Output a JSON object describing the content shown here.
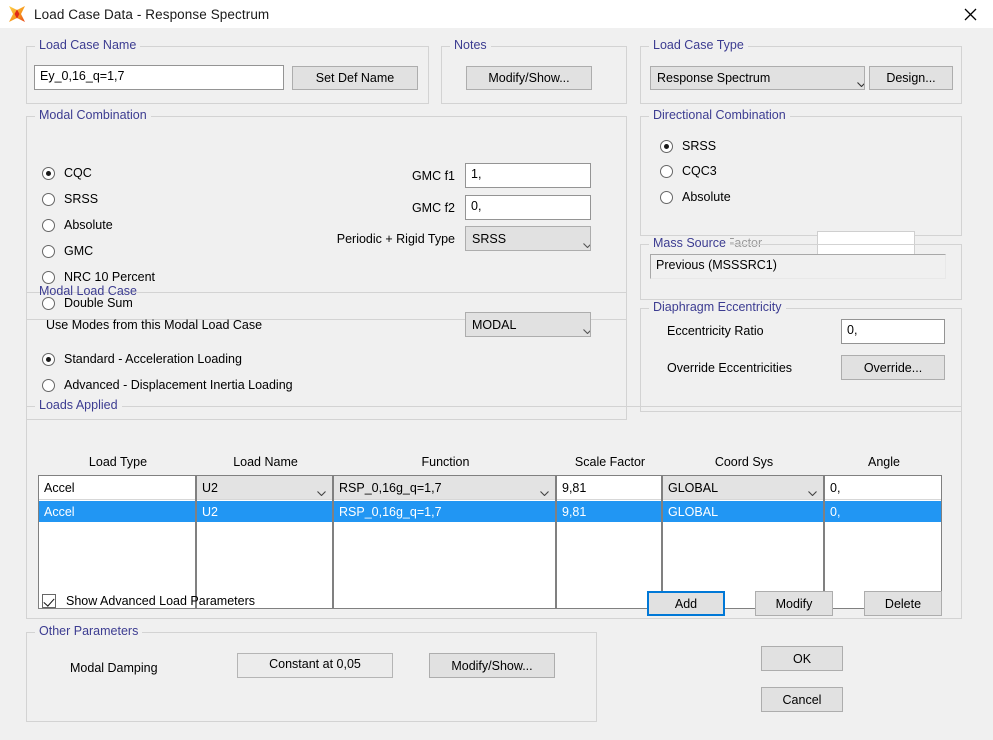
{
  "window": {
    "title": "Load Case Data - Response Spectrum",
    "app_icon": "csi-star-icon",
    "close_icon": "close-icon"
  },
  "load_case_name": {
    "legend": "Load Case Name",
    "value": "Ey_0,16_q=1,7",
    "set_def_name_label": "Set Def Name"
  },
  "notes": {
    "legend": "Notes",
    "modify_show_label": "Modify/Show..."
  },
  "load_case_type": {
    "legend": "Load Case Type",
    "selected": "Response Spectrum",
    "design_label": "Design..."
  },
  "modal_combination": {
    "legend": "Modal Combination",
    "options": [
      {
        "label": "CQC",
        "selected": true
      },
      {
        "label": "SRSS",
        "selected": false
      },
      {
        "label": "Absolute",
        "selected": false
      },
      {
        "label": "GMC",
        "selected": false
      },
      {
        "label": "NRC 10 Percent",
        "selected": false
      },
      {
        "label": "Double Sum",
        "selected": false
      }
    ],
    "gmc_f1_label": "GMC  f1",
    "gmc_f1_value": "1,",
    "gmc_f2_label": "GMC  f2",
    "gmc_f2_value": "0,",
    "periodic_rigid_label": "Periodic + Rigid Type",
    "periodic_rigid_value": "SRSS"
  },
  "modal_load_case": {
    "legend": "Modal Load Case",
    "use_modes_label": "Use Modes from this Modal Load Case",
    "modal_case_value": "MODAL",
    "options": [
      {
        "label": "Standard - Acceleration Loading",
        "selected": true
      },
      {
        "label": "Advanced - Displacement Inertia Loading",
        "selected": false
      }
    ]
  },
  "directional_combination": {
    "legend": "Directional Combination",
    "options": [
      {
        "label": "SRSS",
        "selected": true
      },
      {
        "label": "CQC3",
        "selected": false
      },
      {
        "label": "Absolute",
        "selected": false
      }
    ],
    "scale_factor_label": "Scale Factor",
    "scale_factor_value": ""
  },
  "mass_source": {
    "legend": "Mass Source",
    "value": "Previous  (MSSSRC1)"
  },
  "diaphragm_eccentricity": {
    "legend": "Diaphragm Eccentricity",
    "eccentricity_ratio_label": "Eccentricity Ratio",
    "eccentricity_ratio_value": "0,",
    "override_eccentricities_label": "Override Eccentricities",
    "override_button_label": "Override..."
  },
  "loads_applied": {
    "legend": "Loads Applied",
    "columns": [
      "Load Type",
      "Load Name",
      "Function",
      "Scale Factor",
      "Coord Sys",
      "Angle"
    ],
    "input_row": {
      "load_type": "Accel",
      "load_name": "U2",
      "function": "RSP_0,16g_q=1,7",
      "scale_factor": "9,81",
      "coord_sys": "GLOBAL",
      "angle": "0,"
    },
    "rows": [
      {
        "load_type": "Accel",
        "load_name": "U2",
        "function": "RSP_0,16g_q=1,7",
        "scale_factor": "9,81",
        "coord_sys": "GLOBAL",
        "angle": "0,",
        "selected": true
      }
    ],
    "show_advanced_label": "Show Advanced Load Parameters",
    "show_advanced_checked": true,
    "add_label": "Add",
    "modify_label": "Modify",
    "delete_label": "Delete"
  },
  "other_parameters": {
    "legend": "Other Parameters",
    "modal_damping_label": "Modal Damping",
    "modal_damping_value": "Constant at 0,05",
    "modify_show_label": "Modify/Show..."
  },
  "dialog_buttons": {
    "ok_label": "OK",
    "cancel_label": "Cancel"
  },
  "colors": {
    "legend_text": "#3c3c91",
    "selection": "#2196f3",
    "focus": "#0078d7",
    "dialog_bg": "#f0f0f0"
  }
}
